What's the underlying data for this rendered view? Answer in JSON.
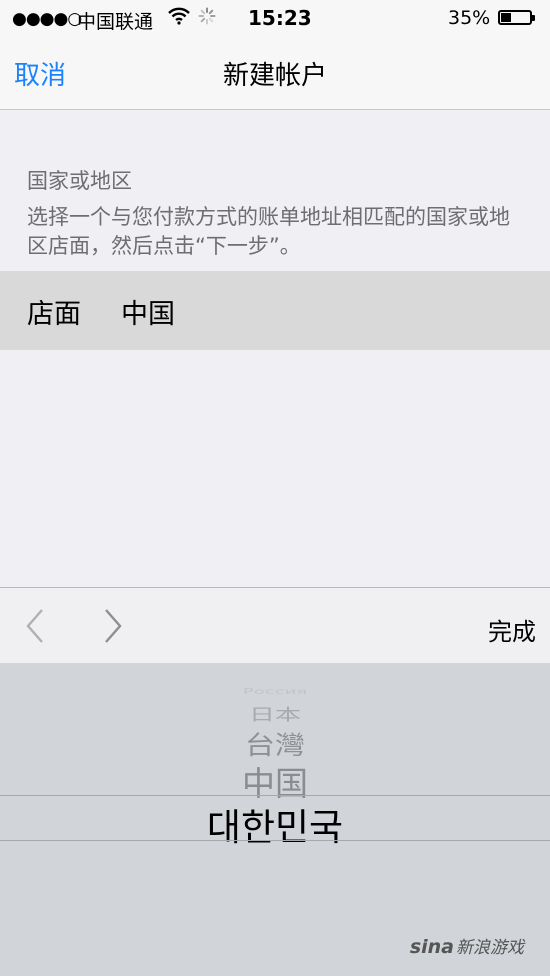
{
  "status_bar": {
    "signal": "●●●●○",
    "carrier": "中国联通",
    "wifi_icon": "wifi-icon",
    "activity_icon": "activity-spinner-icon",
    "time": "15:23",
    "battery_percent": "35%",
    "battery_level": 0.35
  },
  "nav": {
    "cancel_label": "取消",
    "title": "新建帐户"
  },
  "section": {
    "title": "国家或地区",
    "description": "选择一个与您付款方式的账单地址相匹配的国家或地区店面，然后点击“下一步”。"
  },
  "store_row": {
    "label": "店面",
    "value": "中国"
  },
  "toolbar": {
    "prev_icon": "chevron-left-icon",
    "next_icon": "chevron-right-icon",
    "done_label": "完成"
  },
  "picker": {
    "items": [
      "Россия",
      "日本",
      "台灣",
      "中国",
      "대한민국"
    ],
    "selected": "대한민국"
  },
  "watermark": {
    "brand": "sina",
    "text": "新浪游戏"
  },
  "colors": {
    "accent": "#1a82fb",
    "background": "#efeff4",
    "picker_bg": "#d1d4d9",
    "selected_row_bg": "#d9d9d9"
  }
}
